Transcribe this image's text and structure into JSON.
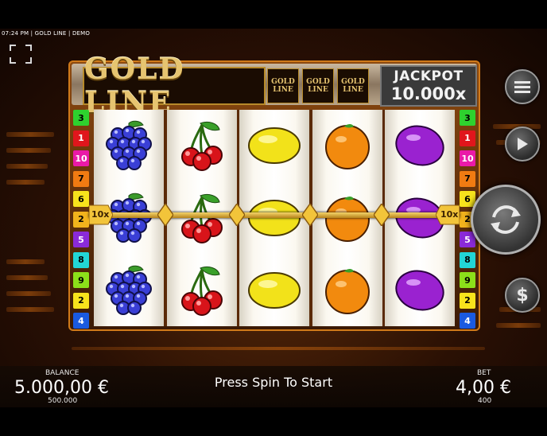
{
  "status_bar": {
    "text": "07:24 PM | GOLD LINE | DEMO"
  },
  "logo": {
    "title": "GOLD LINE",
    "mini_label": "GOLD LINE"
  },
  "jackpot": {
    "label": "JACKPOT",
    "value": "10.000x"
  },
  "paylines_left": [
    "3",
    "1",
    "10",
    "7",
    "6",
    "2",
    "5",
    "8",
    "9",
    "2",
    "4"
  ],
  "paylines_right": [
    "3",
    "1",
    "10",
    "7",
    "6",
    "2",
    "5",
    "8",
    "9",
    "2",
    "4"
  ],
  "multiplier_cap": {
    "left": "10x",
    "right": "10x"
  },
  "reels": [
    [
      "grapes",
      "grapes",
      "grapes"
    ],
    [
      "cherries",
      "cherries",
      "cherries"
    ],
    [
      "lemon",
      "lemon",
      "lemon"
    ],
    [
      "orange",
      "orange",
      "orange"
    ],
    [
      "plum",
      "plum",
      "plum"
    ]
  ],
  "controls": {
    "menu": "menu-icon",
    "autoplay": "play-icon",
    "spin": "spin-icon",
    "bet": "dollar-icon"
  },
  "balance": {
    "label": "BALANCE",
    "value": "5.000,00 €",
    "credits": "500.000"
  },
  "bet": {
    "label": "BET",
    "value": "4,00 €",
    "credits": "400"
  },
  "prompt": "Press Spin To Start",
  "colors": {
    "accent": "#c2620f",
    "gold": "#e6c470",
    "background": "#2a1004"
  }
}
